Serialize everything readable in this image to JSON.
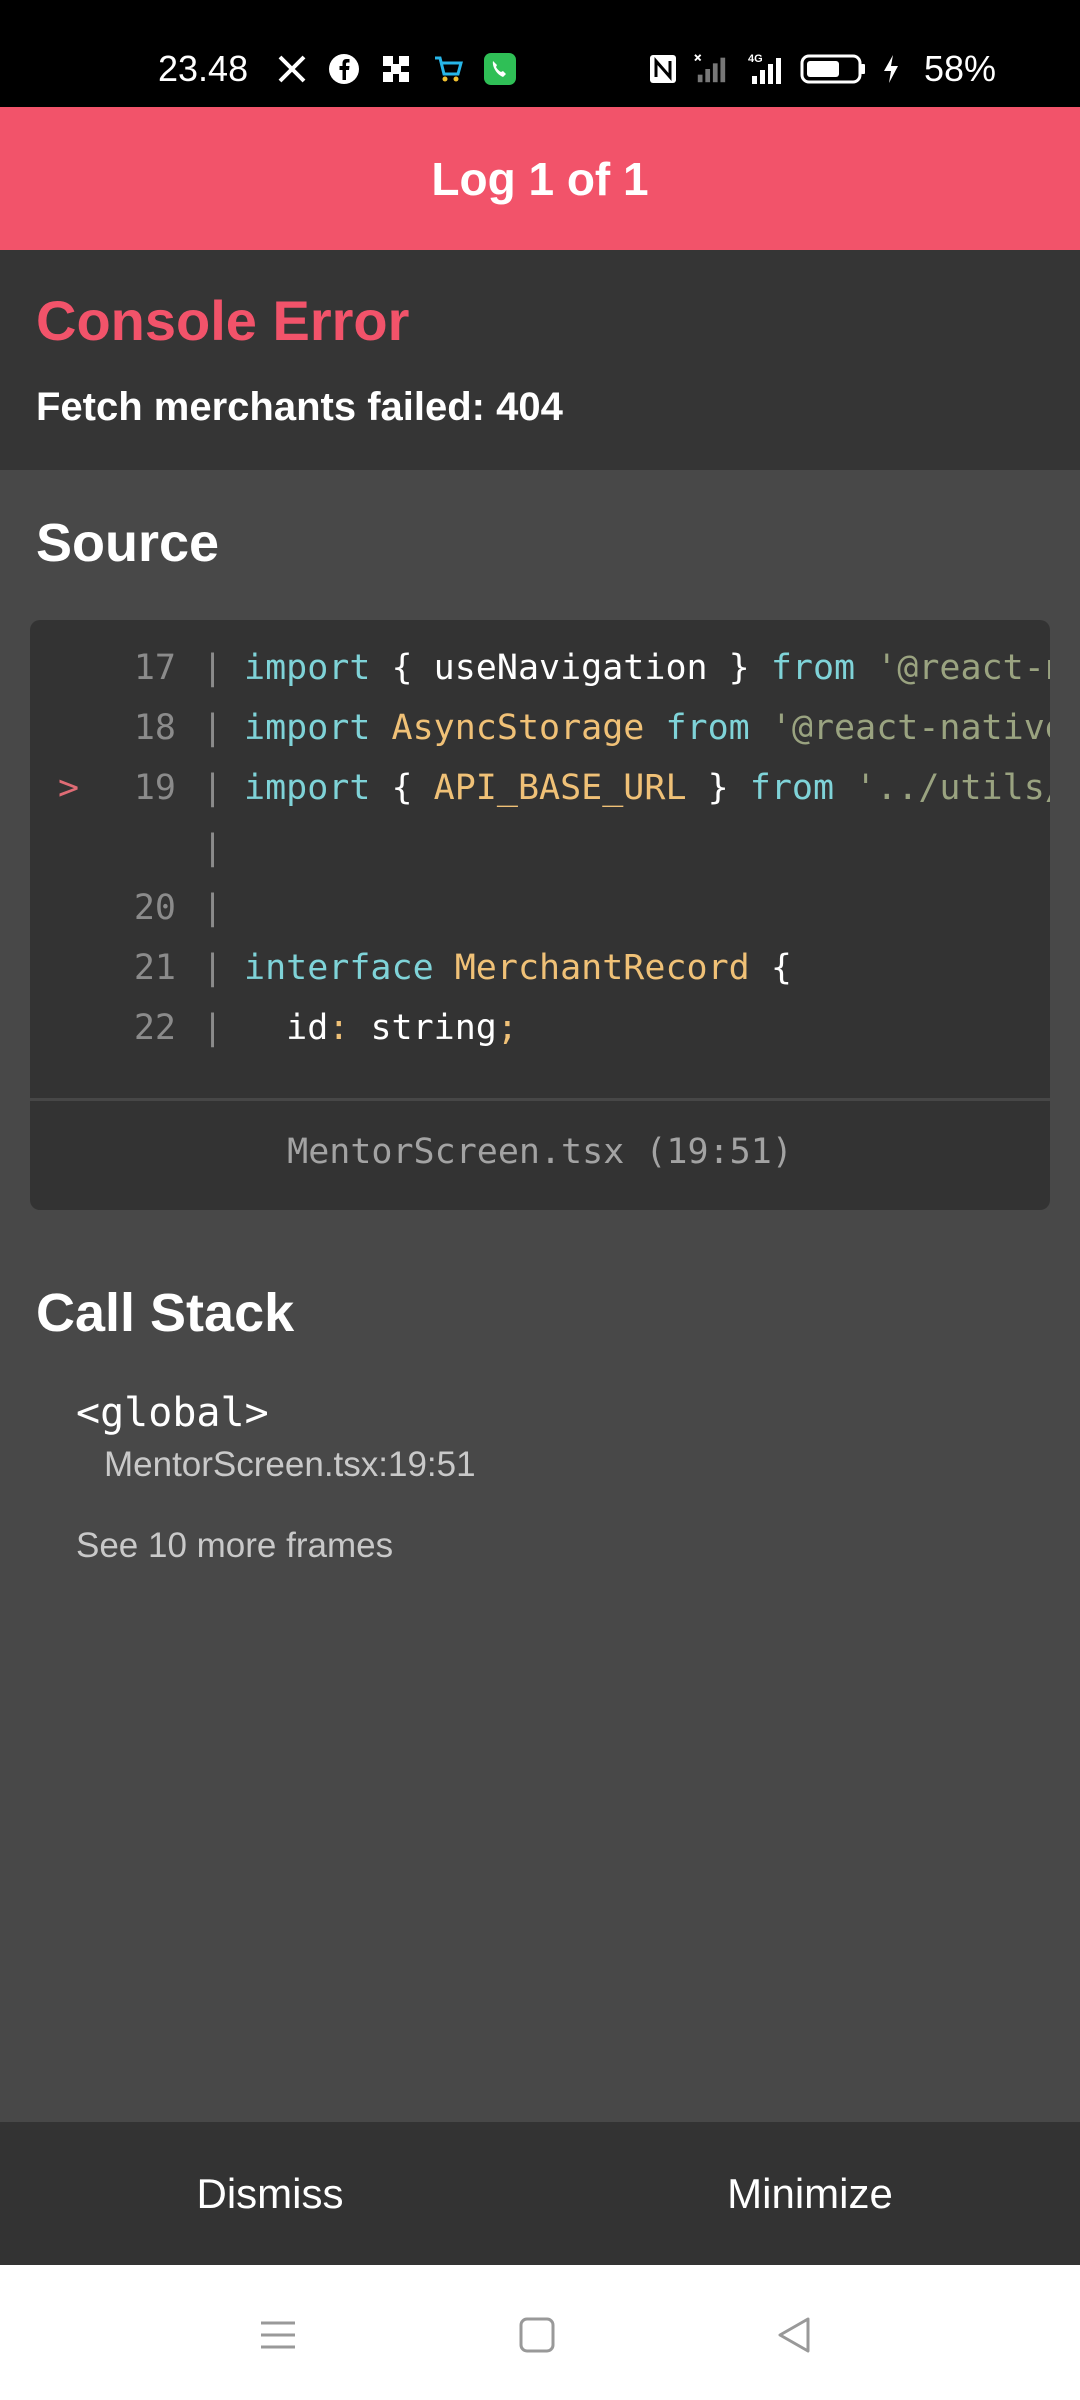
{
  "status_bar": {
    "time": "23.48",
    "battery": "58%",
    "left_icons": [
      "x-icon",
      "facebook-icon",
      "app-icon",
      "shopping-cart-icon",
      "phone-icon"
    ],
    "right_icons": [
      "nfc-icon",
      "signal-icon",
      "4g-signal-icon",
      "battery-icon",
      "charging-icon"
    ],
    "network_label": "4G"
  },
  "header": {
    "title": "Log 1 of 1"
  },
  "error": {
    "title": "Console Error",
    "message": "Fetch merchants failed: 404"
  },
  "source": {
    "title": "Source",
    "lines": [
      {
        "num": "17",
        "marker": "",
        "tokens": [
          [
            "kw",
            "import"
          ],
          [
            "plain",
            " { useNavigation } "
          ],
          [
            "kw",
            "from"
          ],
          [
            "plain",
            " "
          ],
          [
            "str",
            "'@react-navigation/native';"
          ]
        ]
      },
      {
        "num": "18",
        "marker": "",
        "tokens": [
          [
            "kw",
            "import"
          ],
          [
            "plain",
            " "
          ],
          [
            "ty",
            "AsyncStorage"
          ],
          [
            "plain",
            " "
          ],
          [
            "kw",
            "from"
          ],
          [
            "plain",
            " "
          ],
          [
            "str",
            "'@react-native-async-storage';"
          ]
        ]
      },
      {
        "num": "19",
        "marker": ">",
        "tokens": [
          [
            "kw",
            "import"
          ],
          [
            "plain",
            " { "
          ],
          [
            "ty",
            "API_BASE_URL"
          ],
          [
            "plain",
            " } "
          ],
          [
            "kw",
            "from"
          ],
          [
            "plain",
            " "
          ],
          [
            "str",
            "'../utils/config';"
          ]
        ]
      },
      {
        "num": "",
        "marker": "",
        "tokens": []
      },
      {
        "num": "20",
        "marker": "",
        "tokens": []
      },
      {
        "num": "21",
        "marker": "",
        "tokens": [
          [
            "kw",
            "interface"
          ],
          [
            "plain",
            " "
          ],
          [
            "ty",
            "MerchantRecord"
          ],
          [
            "plain",
            " {"
          ]
        ]
      },
      {
        "num": "22",
        "marker": "",
        "tokens": [
          [
            "plain",
            "  id"
          ],
          [
            "punc",
            ":"
          ],
          [
            "plain",
            " string"
          ],
          [
            "punc",
            ";"
          ]
        ]
      }
    ],
    "file": "MentorScreen.tsx (19:51)"
  },
  "call_stack": {
    "title": "Call Stack",
    "frame_name": "<global>",
    "frame_location": "MentorScreen.tsx:19:51",
    "more_frames": "See 10 more frames"
  },
  "buttons": {
    "dismiss": "Dismiss",
    "minimize": "Minimize"
  },
  "nav": {
    "icons": [
      "menu-icon",
      "home-square-icon",
      "back-triangle-icon"
    ]
  },
  "colors": {
    "accent": "#f2536a",
    "background": "#484848",
    "panel": "#353535",
    "code_bg": "#333333"
  }
}
